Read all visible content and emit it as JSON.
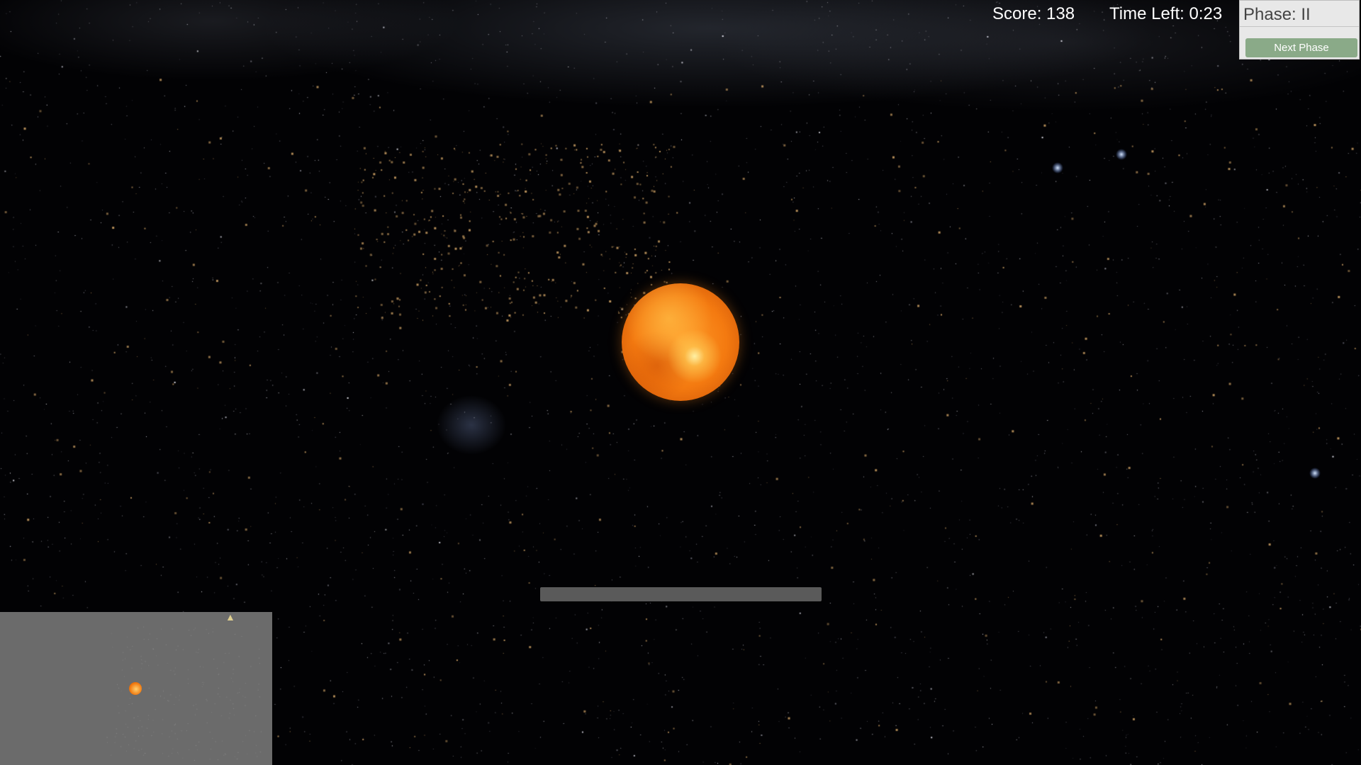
{
  "hud": {
    "score_label": "Score: 138",
    "time_label": "Time Left: 0:23",
    "phase_label": "Phase: II",
    "next_phase_label": "Next Phase"
  },
  "colors": {
    "sun": "#f47a10",
    "next_phase_button": "#8aaa88",
    "minimap_background": "#6b6b6b",
    "asteroid": "#b8905a"
  },
  "progress": {
    "value": 0.0
  },
  "icons": {
    "sun": "sun-icon",
    "ship": "ship-icon"
  }
}
